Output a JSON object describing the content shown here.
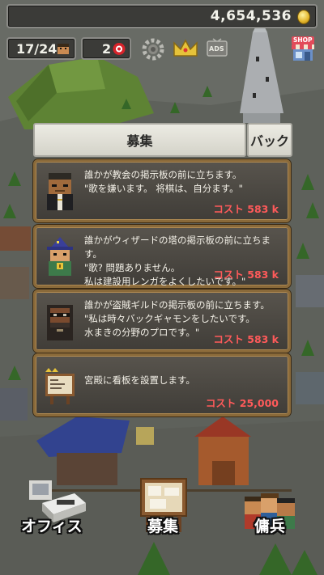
{
  "hud": {
    "gold": "4,654,536",
    "population": "17/24",
    "gems": "2",
    "icons": [
      "coin-icon",
      "villager-icon",
      "gem-icon",
      "settings-gear-icon",
      "crown-icon",
      "ads-icon",
      "shop-icon"
    ],
    "ads_label": "ADS",
    "shop_label": "SHOP"
  },
  "panel": {
    "title": "募集",
    "back_label": "バック",
    "cards": [
      {
        "description": "誰かが教会の掲示板の前に立ちます。\n\"歌を嫌います。 将棋は、自分ます。\"",
        "cost": "コスト 583 k",
        "portrait": "priest-portrait"
      },
      {
        "description": "誰かがウィザードの塔の掲示板の前に立ちます。\n\"歌? 問題ありません。\n私は建設用レンガをよくしたいです。\"",
        "cost": "コスト 583 k",
        "portrait": "wizard-portrait"
      },
      {
        "description": "誰かが盗賊ギルドの掲示板の前に立ちます。\n\"私は時々バックギャモンをしたいです。\n水まきの分野のプロです。\"",
        "cost": "コスト 583 k",
        "portrait": "thief-portrait"
      },
      {
        "description": "宮殿に看板を設置します。",
        "cost": "コスト 25,000",
        "portrait": "signboard-portrait"
      }
    ]
  },
  "nav": {
    "office_label": "オフィス",
    "recruit_label": "募集",
    "mercenary_label": "傭兵"
  },
  "colors": {
    "card_border": "#8a6a3a",
    "cost_text": "#ff5a5a",
    "hud_box": "#3b3b38"
  }
}
